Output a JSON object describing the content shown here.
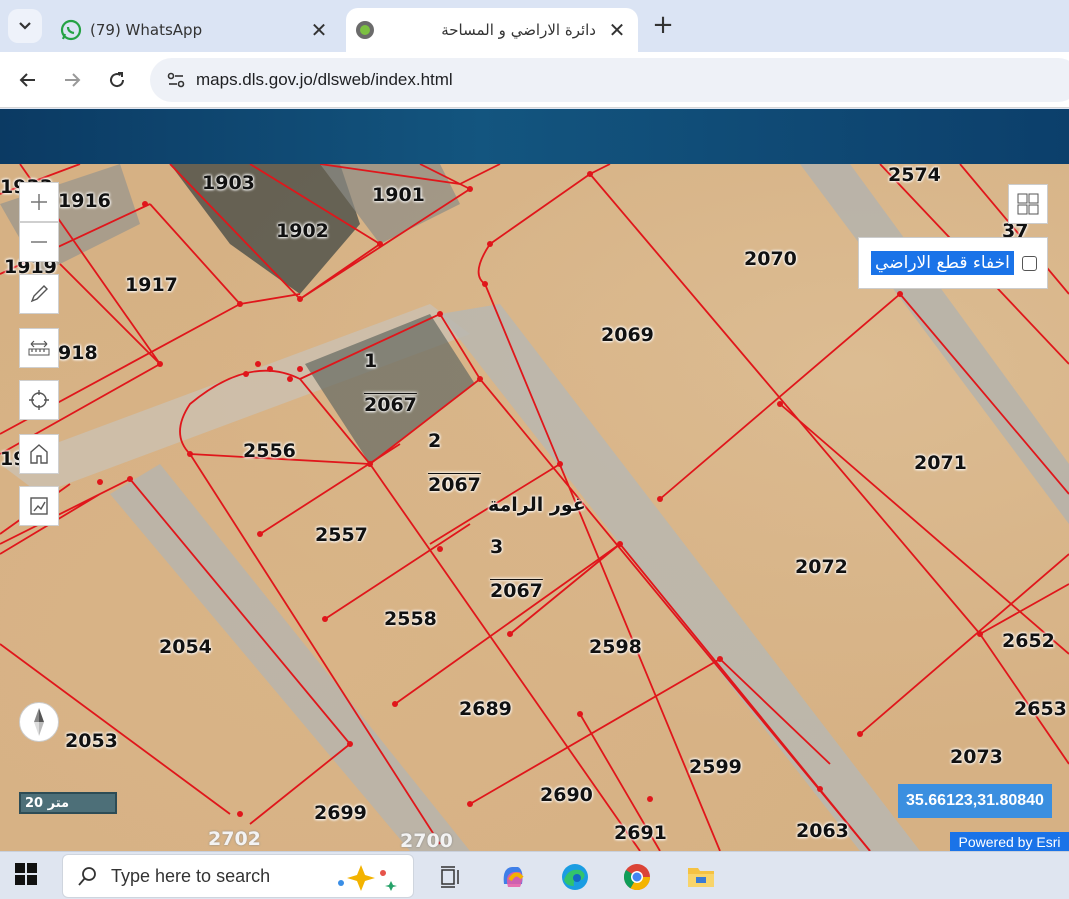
{
  "browser": {
    "tabs": [
      {
        "title": "(79) WhatsApp",
        "icon": "whatsapp-icon",
        "active": false
      },
      {
        "title": "دائرة الاراضي و المساحة",
        "icon": "dls-favicon-icon",
        "active": true
      }
    ],
    "url": "maps.dls.gov.jo/dlsweb/index.html"
  },
  "map": {
    "parcel_labels": [
      {
        "text": "1916"
      },
      {
        "text": "1919"
      },
      {
        "text": "1917"
      },
      {
        "text": "918"
      },
      {
        "text": "1903"
      },
      {
        "text": "1901"
      },
      {
        "text": "1902"
      },
      {
        "text": "2574"
      },
      {
        "text": "37"
      },
      {
        "text": "2070"
      },
      {
        "text": "2069"
      },
      {
        "text": "1"
      },
      {
        "text": "2067"
      },
      {
        "text": "2"
      },
      {
        "text": "2067"
      },
      {
        "text": "2556"
      },
      {
        "text": "2071"
      },
      {
        "text": "2557"
      },
      {
        "text": "3"
      },
      {
        "text": "2067"
      },
      {
        "text": "2072"
      },
      {
        "text": "2558"
      },
      {
        "text": "2598"
      },
      {
        "text": "2652"
      },
      {
        "text": "2054"
      },
      {
        "text": "2689"
      },
      {
        "text": "2653"
      },
      {
        "text": "2053"
      },
      {
        "text": "2599"
      },
      {
        "text": "2073"
      },
      {
        "text": "2690"
      },
      {
        "text": "2699"
      },
      {
        "text": "2702"
      },
      {
        "text": "2700"
      },
      {
        "text": "2691"
      },
      {
        "text": "2063"
      },
      {
        "text": "1933"
      },
      {
        "text": "19"
      }
    ],
    "area_name": "غور الرامة",
    "hide_parcels_label": "اخفاء قطع الاراضي",
    "hide_parcels_checked": false,
    "scale_label": "20 متر",
    "coordinates": "35.66123,31.80840",
    "attribution": "Powered by Esri"
  },
  "taskbar": {
    "search_placeholder": "Type here to search"
  }
}
